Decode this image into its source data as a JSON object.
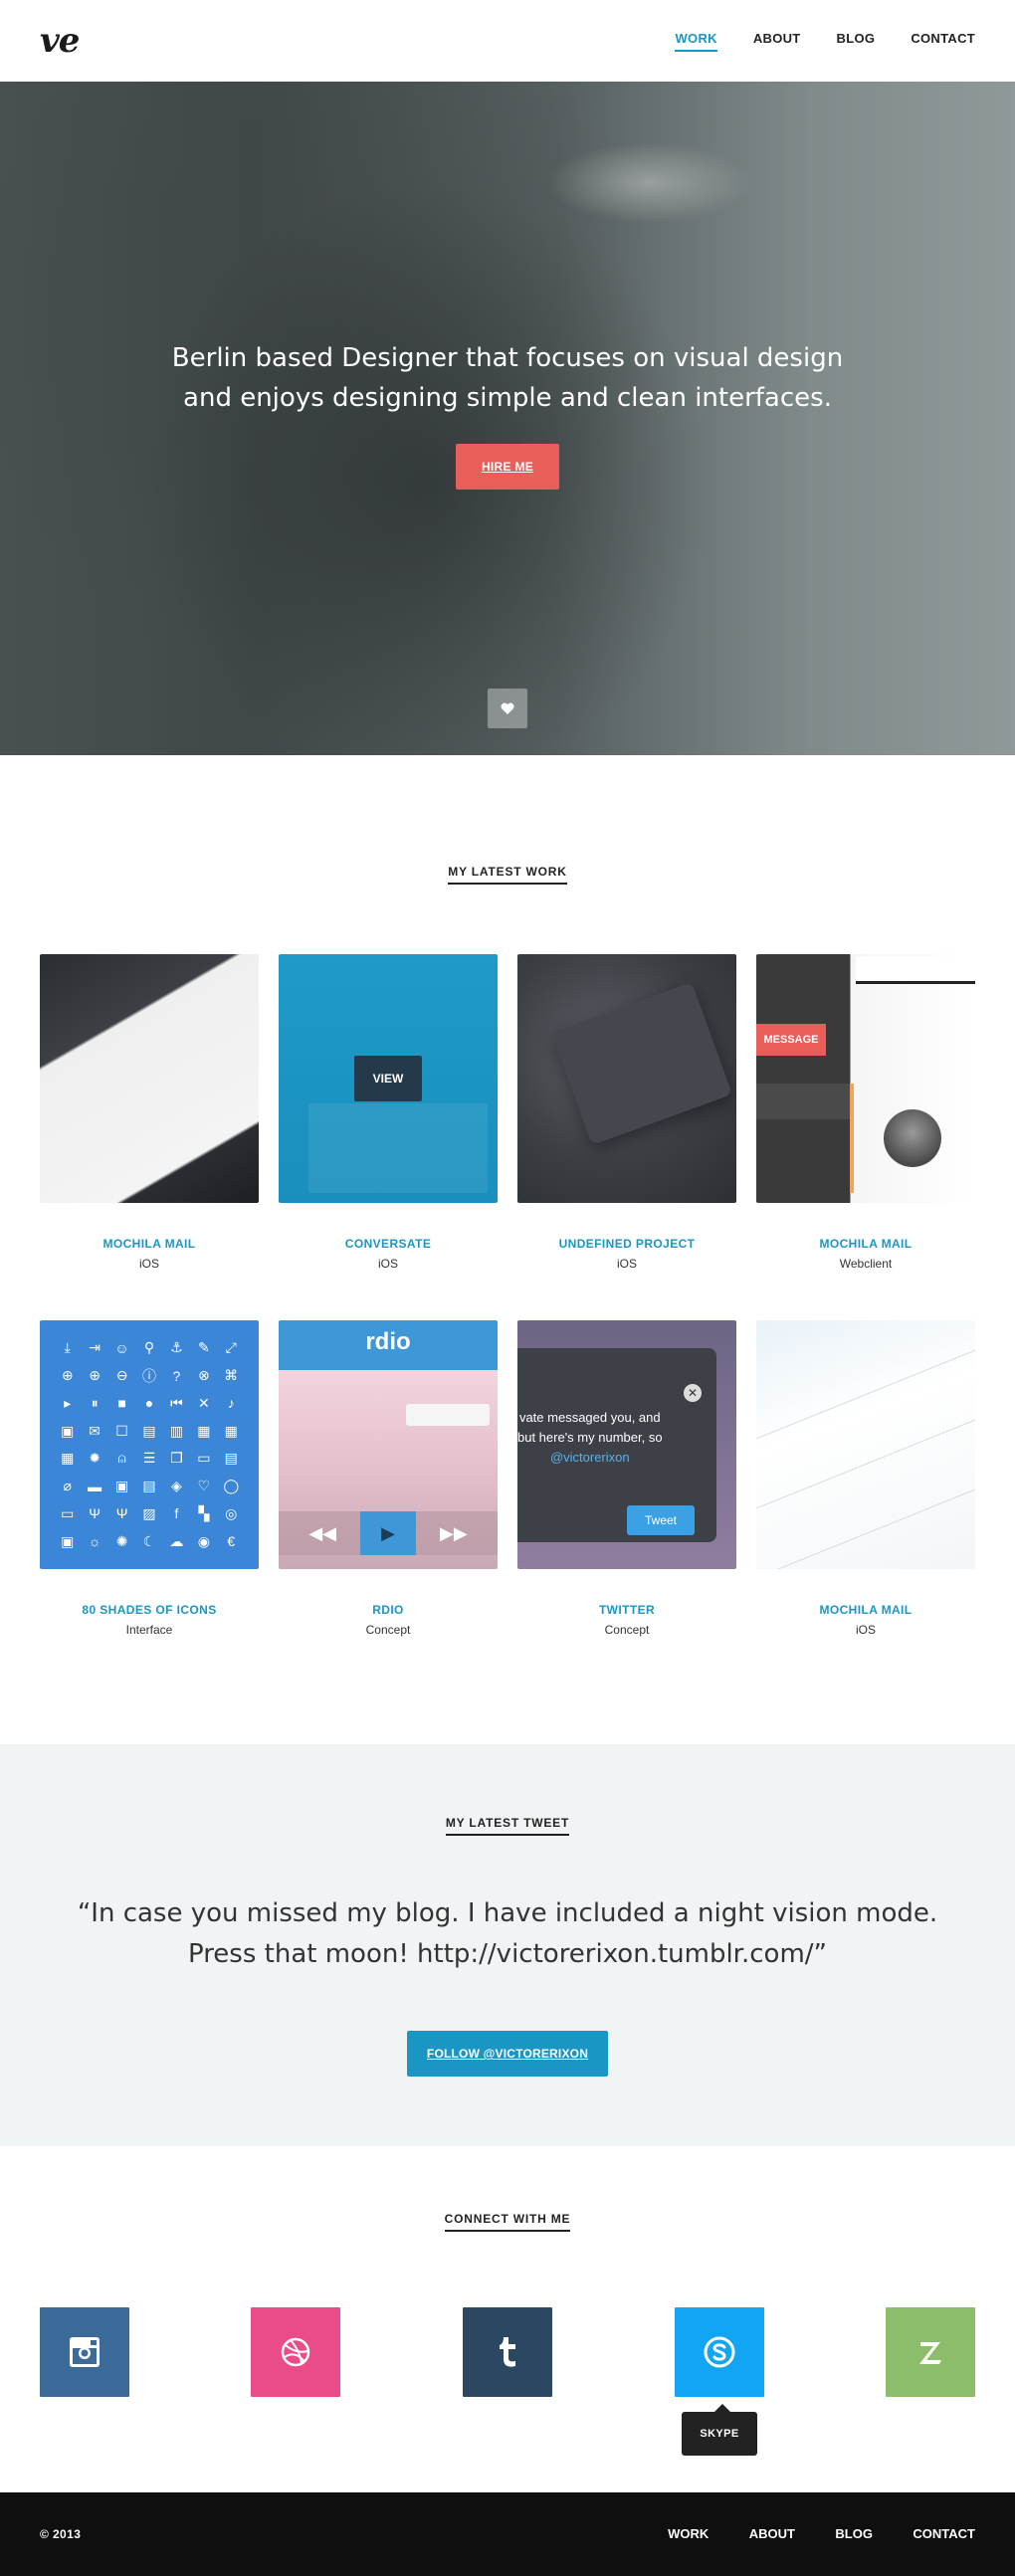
{
  "brand": {
    "logo_text": "ve"
  },
  "nav": {
    "items": [
      {
        "label": "WORK",
        "active": true
      },
      {
        "label": "ABOUT"
      },
      {
        "label": "BLOG"
      },
      {
        "label": "CONTACT"
      }
    ]
  },
  "hero": {
    "line1": "Berlin based Designer that focuses on visual design",
    "line2": "and enjoys designing simple and clean interfaces.",
    "cta_label": "HIRE ME",
    "scroll_icon": "heart-icon"
  },
  "work": {
    "title": "MY LATEST WORK",
    "view_label": "VIEW",
    "items": [
      {
        "title": "MOCHILA MAIL",
        "subtitle": "iOS"
      },
      {
        "title": "CONVERSATE",
        "subtitle": "iOS"
      },
      {
        "title": "UNDEFINED PROJECT",
        "subtitle": "iOS"
      },
      {
        "title": "MOCHILA MAIL",
        "subtitle": "Webclient"
      },
      {
        "title": "80 SHADES OF ICONS",
        "subtitle": "Interface"
      },
      {
        "title": "RDIO",
        "subtitle": "Concept"
      },
      {
        "title": "TWITTER",
        "subtitle": "Concept"
      },
      {
        "title": "MOCHILA MAIL",
        "subtitle": "iOS"
      }
    ],
    "thumb_texts": {
      "message_label": "MESSAGE",
      "rdio_logo": "rdio",
      "twitter_line1": "vate messaged you, and",
      "twitter_line2": "but here's my number, so",
      "twitter_handle": "@victorerixon",
      "tweet_button": "Tweet"
    }
  },
  "tweet": {
    "title": "MY LATEST TWEET",
    "line1": "“In case you missed my blog. I have included a night vision mode.",
    "line2": "Press that moon! http://victorerixon.tumblr.com/”",
    "follow_label": "FOLLOW @VICTORERIXON"
  },
  "connect": {
    "title": "CONNECT WITH ME",
    "socials": [
      {
        "name": "instagram-icon",
        "color": "#3c6b99"
      },
      {
        "name": "dribbble-icon",
        "color": "#ea4c89"
      },
      {
        "name": "tumblr-icon",
        "color": "#2c4762"
      },
      {
        "name": "skype-icon",
        "color": "#12a5f4"
      },
      {
        "name": "zerply-icon",
        "color": "#8cbd6a"
      }
    ],
    "tooltip": "SKYPE"
  },
  "footer": {
    "copyright": "© 2013",
    "nav": [
      "WORK",
      "ABOUT",
      "BLOG",
      "CONTACT"
    ]
  },
  "colors": {
    "accent": "#1a96c4",
    "cta": "#e95e59",
    "tweet_bg": "#f1f4f4",
    "footer_bg": "#0f0f0f"
  }
}
